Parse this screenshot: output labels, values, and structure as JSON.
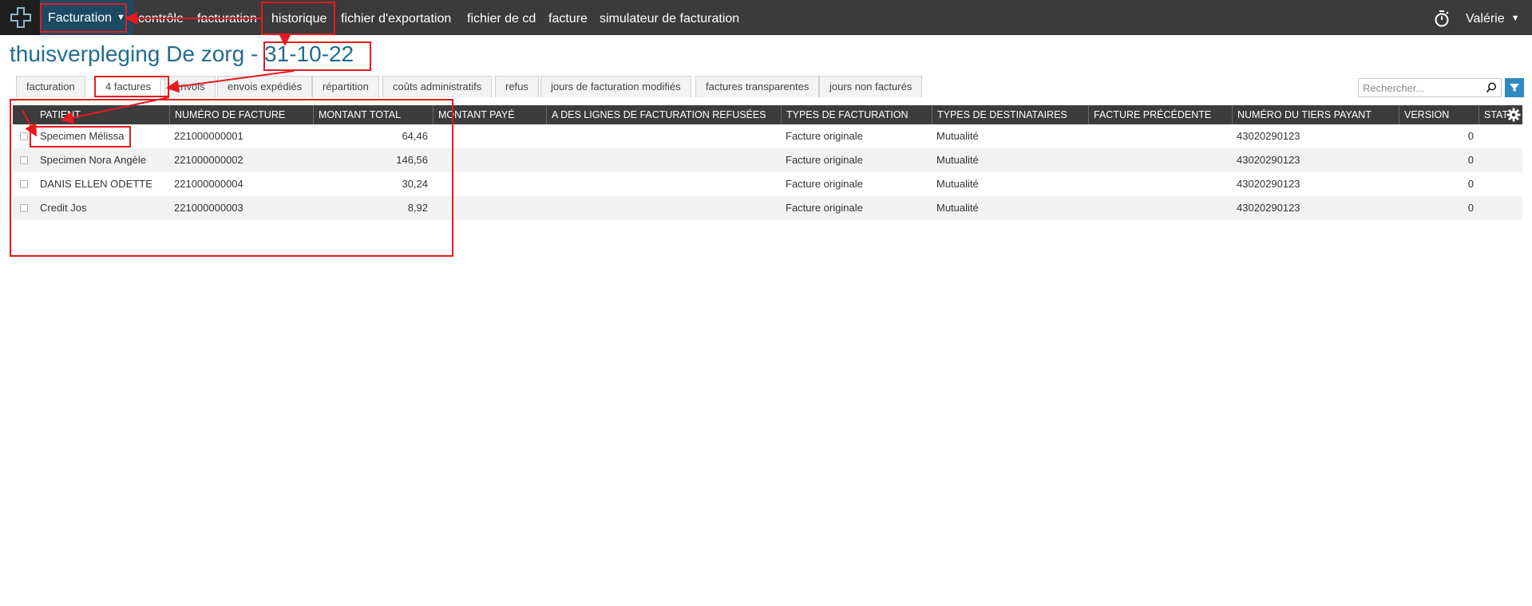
{
  "app": {
    "module": "Facturation",
    "nav": [
      "contrôle",
      "facturation",
      "historique",
      "fichier d'exportation",
      "fichier de cd",
      "facture",
      "simulateur de facturation"
    ],
    "user": "Valérie"
  },
  "title": {
    "prefix": "thuisverpleging De zorg - ",
    "date": "31-10-22"
  },
  "tabs": [
    "facturation",
    "4 factures",
    "envois",
    "envois expédiés",
    "répartition",
    "coûts administratifs",
    "refus",
    "jours de facturation modifiés",
    "factures transparentes",
    "jours non facturés"
  ],
  "active_tab": "4 factures",
  "search": {
    "placeholder": "Rechercher..."
  },
  "table": {
    "columns": [
      "PATIENT",
      "NUMÉRO DE FACTURE",
      "MONTANT TOTAL",
      "MONTANT PAYÉ",
      "A DES LIGNES DE FACTURATION REFUSÉES",
      "TYPES DE FACTURATION",
      "TYPES DE DESTINATAIRES",
      "FACTURE PRÉCÉDENTE",
      "NUMÉRO DU TIERS PAYANT",
      "VERSION",
      "STAT"
    ],
    "rows": [
      {
        "patient": "Specimen Mélissa",
        "numero": "221000000001",
        "montant_total": "64,46",
        "montant_paye": "",
        "refusees": "",
        "type_facturation": "Facture originale",
        "type_destinataire": "Mutualité",
        "facture_precedente": "",
        "tiers_payant": "43020290123",
        "version": "0"
      },
      {
        "patient": "Specimen Nora Angèle",
        "numero": "221000000002",
        "montant_total": "146,56",
        "montant_paye": "",
        "refusees": "",
        "type_facturation": "Facture originale",
        "type_destinataire": "Mutualité",
        "facture_precedente": "",
        "tiers_payant": "43020290123",
        "version": "0"
      },
      {
        "patient": "DANIS ELLEN ODETTE",
        "numero": "221000000004",
        "montant_total": "30,24",
        "montant_paye": "",
        "refusees": "",
        "type_facturation": "Facture originale",
        "type_destinataire": "Mutualité",
        "facture_precedente": "",
        "tiers_payant": "43020290123",
        "version": "0"
      },
      {
        "patient": "Credit Jos",
        "numero": "221000000003",
        "montant_total": "8,92",
        "montant_paye": "",
        "refusees": "",
        "type_facturation": "Facture originale",
        "type_destinataire": "Mutualité",
        "facture_precedente": "",
        "tiers_payant": "43020290123",
        "version": "0"
      }
    ]
  },
  "colors": {
    "topbar": "#3b3b3b",
    "module_bg": "#1b4a62",
    "title": "#1f6c90",
    "annotation": "#e8191f",
    "filter_button": "#2f8ac4"
  },
  "icons": [
    "logo-cross-icon",
    "chevron-down-icon",
    "stopwatch-icon",
    "search-icon",
    "filter-icon",
    "gear-icon"
  ]
}
